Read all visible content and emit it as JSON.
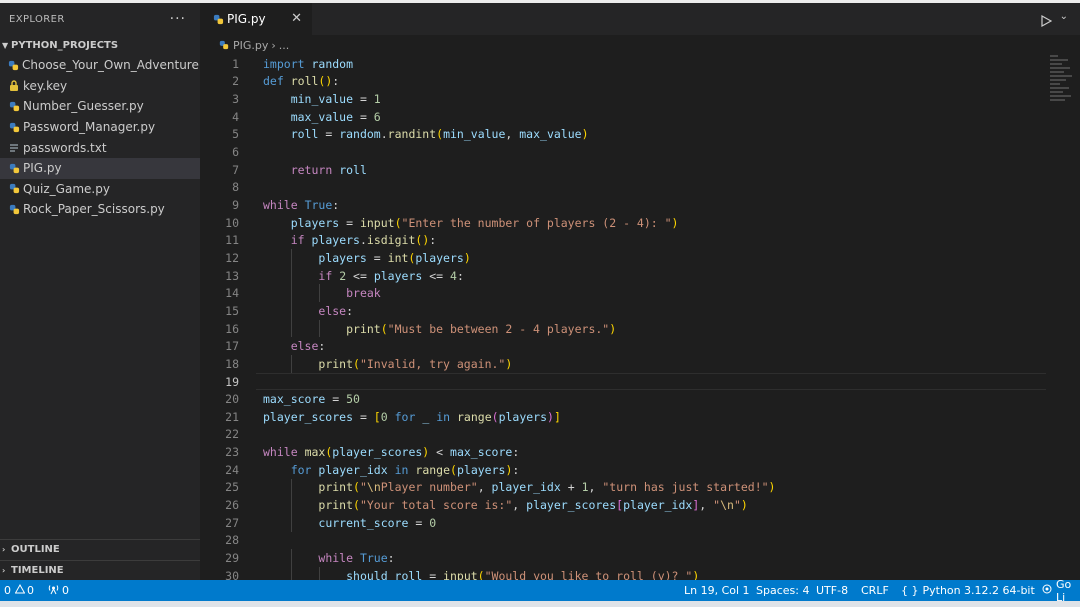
{
  "sidebar": {
    "title": "EXPLORER",
    "more": "···",
    "folder": "PYTHON_PROJECTS",
    "files": [
      {
        "name": "Choose_Your_Own_Adventure.py",
        "icon": "python-icon"
      },
      {
        "name": "key.key",
        "icon": "lock-icon"
      },
      {
        "name": "Number_Guesser.py",
        "icon": "python-icon"
      },
      {
        "name": "Password_Manager.py",
        "icon": "python-icon"
      },
      {
        "name": "passwords.txt",
        "icon": "text-file-icon"
      },
      {
        "name": "PIG.py",
        "icon": "python-icon",
        "active": true
      },
      {
        "name": "Quiz_Game.py",
        "icon": "python-icon"
      },
      {
        "name": "Rock_Paper_Scissors.py",
        "icon": "python-icon"
      }
    ],
    "outline": "OUTLINE",
    "timeline": "TIMELINE"
  },
  "tab": {
    "name": "PIG.py",
    "close": "✕"
  },
  "breadcrumb": {
    "file": "PIG.py",
    "sep": "›",
    "rest": "..."
  },
  "editor": {
    "current_line": 19,
    "lines": [
      {
        "n": "1",
        "t": "import random"
      },
      {
        "n": "2",
        "t": "def roll():"
      },
      {
        "n": "3",
        "t": "    min_value = 1"
      },
      {
        "n": "4",
        "t": "    max_value = 6"
      },
      {
        "n": "5",
        "t": "    roll = random.randint(min_value, max_value)"
      },
      {
        "n": "6",
        "t": ""
      },
      {
        "n": "7",
        "t": "    return roll"
      },
      {
        "n": "8",
        "t": ""
      },
      {
        "n": "9",
        "t": "while True:"
      },
      {
        "n": "10",
        "t": "    players = input(\"Enter the number of players (2 - 4): \")"
      },
      {
        "n": "11",
        "t": "    if players.isdigit():"
      },
      {
        "n": "12",
        "t": "        players = int(players)"
      },
      {
        "n": "13",
        "t": "        if 2 <= players <= 4:"
      },
      {
        "n": "14",
        "t": "            break"
      },
      {
        "n": "15",
        "t": "        else:"
      },
      {
        "n": "16",
        "t": "            print(\"Must be between 2 - 4 players.\")"
      },
      {
        "n": "17",
        "t": "    else:"
      },
      {
        "n": "18",
        "t": "        print(\"Invalid, try again.\")"
      },
      {
        "n": "19",
        "t": ""
      },
      {
        "n": "20",
        "t": "max_score = 50"
      },
      {
        "n": "21",
        "t": "player_scores = [0 for _ in range(players)]"
      },
      {
        "n": "22",
        "t": ""
      },
      {
        "n": "23",
        "t": "while max(player_scores) < max_score:"
      },
      {
        "n": "24",
        "t": "    for player_idx in range(players):"
      },
      {
        "n": "25",
        "t": "        print(\"\\nPlayer number\", player_idx + 1, \"turn has just started!\")"
      },
      {
        "n": "26",
        "t": "        print(\"Your total score is:\", player_scores[player_idx], \"\\n\")"
      },
      {
        "n": "27",
        "t": "        current_score = 0"
      },
      {
        "n": "28",
        "t": ""
      },
      {
        "n": "29",
        "t": "        while True:"
      },
      {
        "n": "30",
        "t": "            should_roll = input(\"Would you like to roll (y)? \")"
      }
    ]
  },
  "status": {
    "errors": "0",
    "warnings": "0",
    "ports": "0",
    "position": "Ln 19, Col 1",
    "spaces": "Spaces: 4",
    "encoding": "UTF-8",
    "eol": "CRLF",
    "language": "Python",
    "interpreter": "3.12.2 64-bit",
    "golive": "Go Li"
  },
  "colors": {
    "status_bar": "#007acc",
    "sidebar": "#252526",
    "editor": "#1e1e1e",
    "keyword": "#569cd6",
    "control": "#c586c0",
    "function": "#dcdcaa",
    "string": "#ce9178",
    "number": "#b5cea8"
  }
}
